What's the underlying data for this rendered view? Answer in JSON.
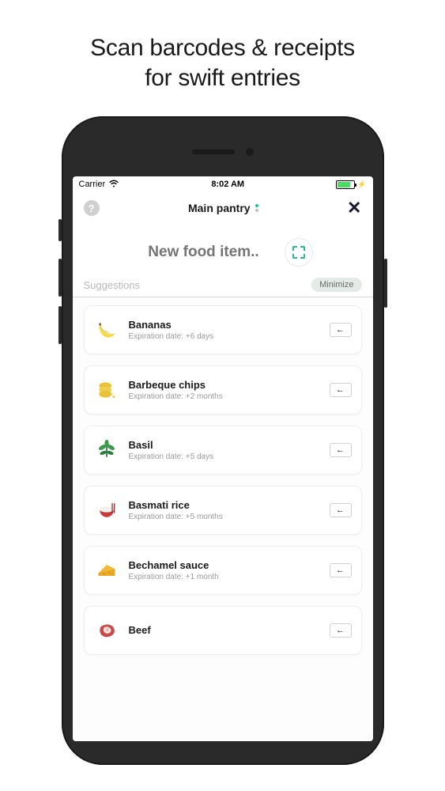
{
  "promo": {
    "line1": "Scan barcodes & receipts",
    "line2": "for swift entries"
  },
  "status": {
    "carrier": "Carrier",
    "time": "8:02 AM"
  },
  "header": {
    "title": "Main pantry",
    "help_glyph": "?",
    "close_glyph": "✕"
  },
  "input": {
    "placeholder": "New food item.."
  },
  "suggestions": {
    "label": "Suggestions",
    "minimize_label": "Minimize"
  },
  "items": [
    {
      "name": "Bananas",
      "expiration": "Expiration date: +6 days",
      "icon": "banana"
    },
    {
      "name": "Barbeque chips",
      "expiration": "Expiration date: +2 months",
      "icon": "chips"
    },
    {
      "name": "Basil",
      "expiration": "Expiration date: +5 days",
      "icon": "basil"
    },
    {
      "name": "Basmati rice",
      "expiration": "Expiration date: +5 months",
      "icon": "rice"
    },
    {
      "name": "Bechamel sauce",
      "expiration": "Expiration date: +1 month",
      "icon": "cheese"
    },
    {
      "name": "Beef",
      "expiration": "",
      "icon": "beef"
    }
  ],
  "add_arrow_glyph": "←"
}
